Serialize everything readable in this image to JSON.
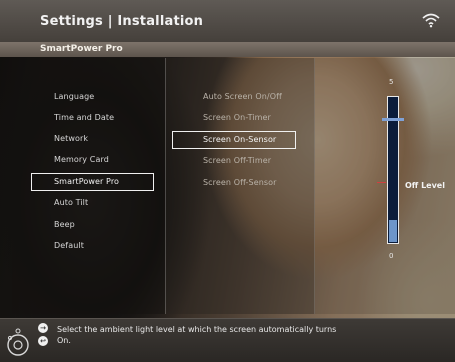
{
  "header": {
    "title": "Settings | Installation",
    "subtitle": "SmartPower Pro",
    "status_icon": "wifi-icon"
  },
  "menu": {
    "items": [
      {
        "label": "Language"
      },
      {
        "label": "Time and Date"
      },
      {
        "label": "Network"
      },
      {
        "label": "Memory Card"
      },
      {
        "label": "SmartPower Pro",
        "selected": true
      },
      {
        "label": "Auto Tilt"
      },
      {
        "label": "Beep"
      },
      {
        "label": "Default"
      }
    ]
  },
  "submenu": {
    "items": [
      {
        "label": "Auto Screen On/Off"
      },
      {
        "label": "Screen On-Timer"
      },
      {
        "label": "Screen On-Sensor",
        "selected": true
      },
      {
        "label": "Screen Off-Timer"
      },
      {
        "label": "Screen Off-Sensor"
      }
    ]
  },
  "slider": {
    "max_label": "5",
    "min_label": "0",
    "off_level_label": "Off Level",
    "value_fraction": 0.85,
    "fill_fraction": 0.15,
    "colors": {
      "track": "#0b1c3a",
      "fill": "#6d95c9",
      "marker": "#d04040"
    }
  },
  "help": {
    "text": "Select the ambient light level at which the screen automatically turns On.",
    "icons": [
      "dpad-icon",
      "ok-button-icon",
      "back-button-icon"
    ]
  }
}
